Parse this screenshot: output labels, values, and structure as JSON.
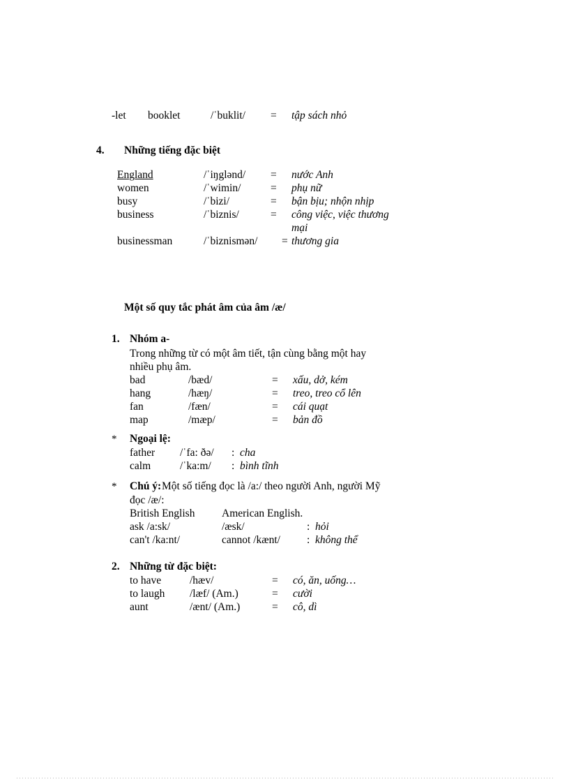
{
  "page": {
    "top_entry": {
      "suffix": "-let",
      "word": "booklet",
      "phonetic": "/ˈbuklit/",
      "equals": "=",
      "meaning": "tập sách nhỏ"
    },
    "section4": {
      "number": "4.",
      "title": "Những tiếng đặc biệt",
      "entries": [
        {
          "word": "England",
          "underline": true,
          "phonetic": "/ˈiŋglənd/",
          "equals": "=",
          "meaning": "nước Anh"
        },
        {
          "word": "women",
          "underline": false,
          "phonetic": "/ˈwimin/",
          "equals": "=",
          "meaning": "phụ nữ"
        },
        {
          "word": "busy",
          "underline": false,
          "phonetic": "/ˈbizi/",
          "equals": "=",
          "meaning": "bận bịu; nhộn nhịp"
        },
        {
          "word": "business",
          "underline": false,
          "phonetic": "/ˈbiznis/",
          "equals": "=",
          "meaning": "công việc, việc thương"
        },
        {
          "word": "",
          "underline": false,
          "phonetic": "",
          "equals": "",
          "meaning": "mại"
        },
        {
          "word": "businessman",
          "underline": false,
          "phonetic": "/ˈbiznismən/",
          "equals": "=",
          "meaning": "thương gia"
        }
      ]
    },
    "main_heading": "Một số quy tắc phát âm của âm /æ/",
    "section1": {
      "number": "1.",
      "title": "Nhóm a-",
      "intro_line1": "Trong những từ có một âm tiết, tận cùng bằng một hay",
      "intro_line2": "nhiều phụ âm.",
      "entries": [
        {
          "word": "bad",
          "phonetic": "/bæd/",
          "equals": "=",
          "meaning": "xấu, dở, kém"
        },
        {
          "word": "hang",
          "phonetic": "/hæŋ/",
          "equals": "=",
          "meaning": "treo, treo cổ lên"
        },
        {
          "word": "fan",
          "phonetic": "/fæn/",
          "equals": "=",
          "meaning": "cái quạt"
        },
        {
          "word": "map",
          "phonetic": "/mæp/",
          "equals": "=",
          "meaning": "bản đồ"
        }
      ],
      "exception": {
        "marker": "*",
        "title": "Ngoại lệ:",
        "entries": [
          {
            "word": "father",
            "phonetic": "/ˈfa: ðə/",
            "colon": ":",
            "meaning": "cha"
          },
          {
            "word": "calm",
            "phonetic": "/ˈka:m/",
            "colon": ":",
            "meaning": "bình tĩnh"
          }
        ]
      },
      "note": {
        "marker": "*",
        "title": "Chú ý:",
        "line1_rest": "Một số tiếng đọc là /a:/ theo người Anh, người Mỹ",
        "line2": "đọc /æ/:",
        "col_headers": {
          "british": "British English",
          "american": "American English."
        },
        "rows": [
          {
            "british": "ask /a:sk/",
            "american": "/æsk/",
            "colon": ":",
            "meaning": "hỏi"
          },
          {
            "british": "can't /ka:nt/",
            "american": "cannot /kænt/",
            "colon": ":",
            "meaning": "không thể"
          }
        ]
      }
    },
    "section2": {
      "number": "2.",
      "title": "Những từ đặc biệt:",
      "entries": [
        {
          "word": "to have",
          "phonetic": "/hæv/",
          "equals": "=",
          "meaning": "có, ăn, uống…"
        },
        {
          "word": "to laugh",
          "phonetic": "/læf/ (Am.)",
          "equals": "=",
          "meaning": "cười"
        },
        {
          "word": "aunt",
          "phonetic": "/ænt/ (Am.)",
          "equals": "=",
          "meaning": "cô, dì"
        }
      ]
    }
  }
}
